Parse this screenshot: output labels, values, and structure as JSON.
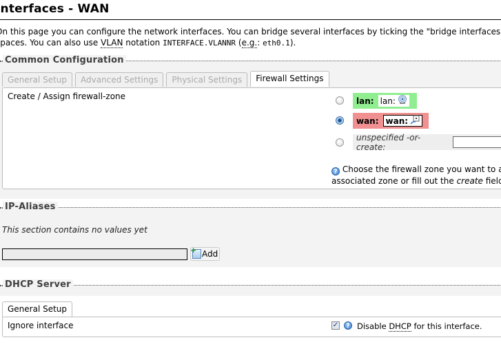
{
  "page": {
    "title": "Interfaces - WAN",
    "intro_line1": "On this page you can configure the network interfaces. You can bridge several interfaces by ticking the \"bridge interfaces\" field and enter the names of several network interfaces separated by",
    "intro_line2_prefix": "spaces. You can also use ",
    "intro_vlan_abbr": "VLAN",
    "intro_line2_mid": " notation ",
    "intro_vlan_notation": "INTERFACE.VLANNR",
    "intro_eg_open": " (",
    "intro_eg_abbr": "e.g.",
    "intro_eg_colon": ": ",
    "intro_example": "eth0.1",
    "intro_end": ")."
  },
  "common_config": {
    "legend": "Common Configuration",
    "tabs": [
      {
        "label": "General Setup",
        "active": false
      },
      {
        "label": "Advanced Settings",
        "active": false
      },
      {
        "label": "Physical Settings",
        "active": false
      },
      {
        "label": "Firewall Settings",
        "active": true
      }
    ],
    "field_label": "Create / Assign firewall-zone",
    "zones": [
      {
        "name": "lan:",
        "network": "lan:",
        "icon": "network-wireless-icon",
        "color": "#90ee90",
        "checked": false
      },
      {
        "name": "wan:",
        "network": "wan:",
        "icon": "network-ethernet-icon",
        "color": "#f09090",
        "checked": true
      }
    ],
    "unspecified_label": "unspecified -or- create:",
    "create_value": "",
    "help_line1": "Choose the firewall zone you want to assign to this interface. Select",
    "help_line2_prefix": "associated zone or fill out the ",
    "help_line2_em": "create",
    "help_line2_suffix": " field to define a new zone and attach the interface to it."
  },
  "ip_aliases": {
    "legend": "IP-Aliases",
    "empty_text": "This section contains no values yet",
    "new_value": "",
    "add_label": "Add"
  },
  "dhcp_server": {
    "legend": "DHCP Server",
    "tabs": [
      {
        "label": "General Setup",
        "active": true
      }
    ],
    "ignore_label": "Ignore interface",
    "ignore_checked": true,
    "desc_prefix": "Disable ",
    "desc_abbr": "DHCP",
    "desc_suffix": " for this interface."
  }
}
